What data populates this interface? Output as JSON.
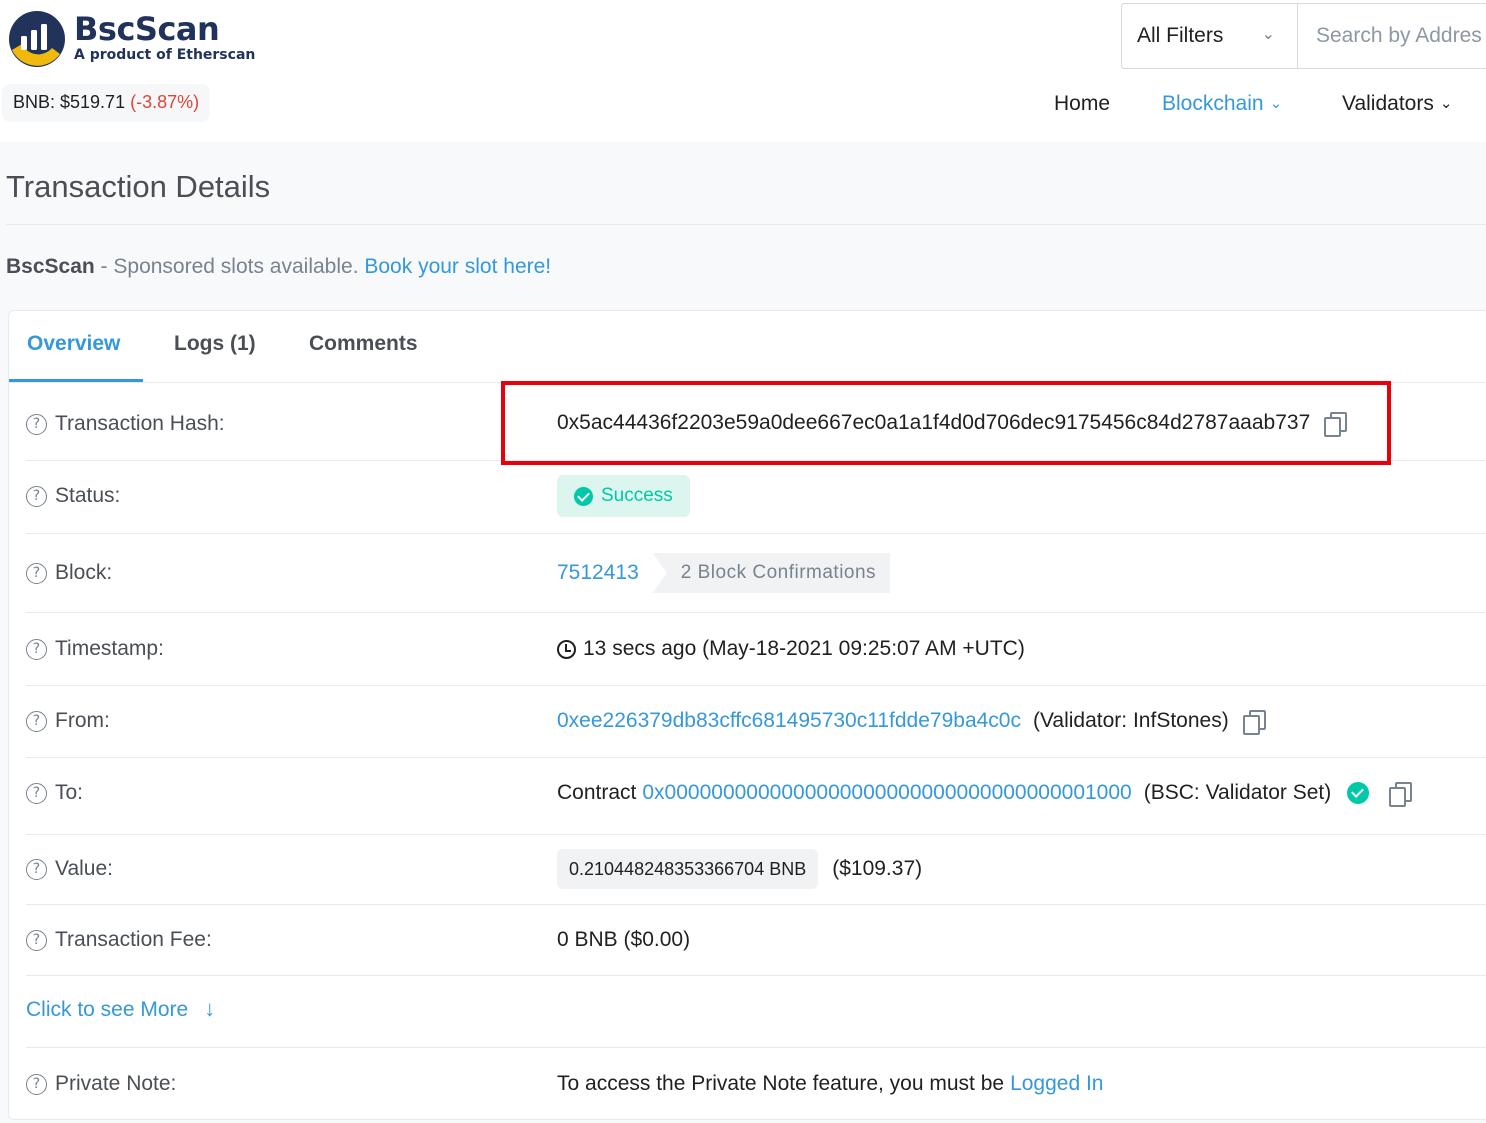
{
  "header": {
    "brand": "BscScan",
    "tagline": "A product of Etherscan",
    "price_label": "BNB: $519.71",
    "price_change": "(-3.87%)",
    "filter_label": "All Filters",
    "search_placeholder": "Search by Addres",
    "nav": [
      {
        "label": "Home"
      },
      {
        "label": "Blockchain"
      },
      {
        "label": "Validators"
      }
    ]
  },
  "page": {
    "title": "Transaction Details",
    "sponsor_brand": "BscScan",
    "sponsor_text": " - Sponsored slots available. ",
    "sponsor_link": "Book your slot here!"
  },
  "tabs": [
    {
      "label": "Overview"
    },
    {
      "label": "Logs (1)"
    },
    {
      "label": "Comments"
    }
  ],
  "details": {
    "hash": {
      "label": "Transaction Hash:",
      "value": "0x5ac44436f2203e59a0dee667ec0a1a1f4d0d706dec9175456c84d2787aaab737"
    },
    "status": {
      "label": "Status:",
      "value": "Success"
    },
    "block": {
      "label": "Block:",
      "number": "7512413",
      "confirmations": "2 Block Confirmations"
    },
    "timestamp": {
      "label": "Timestamp:",
      "value": "13 secs ago (May-18-2021 09:25:07 AM +UTC)"
    },
    "from": {
      "label": "From:",
      "address": "0xee226379db83cffc681495730c11fdde79ba4c0c",
      "name": "(Validator: InfStones)"
    },
    "to": {
      "label": "To:",
      "prefix": "Contract",
      "address": "0x0000000000000000000000000000000000001000",
      "name": "(BSC: Validator Set)"
    },
    "value": {
      "label": "Value:",
      "amount": "0.210448248353366704 BNB",
      "usd": "($109.37)"
    },
    "fee": {
      "label": "Transaction Fee:",
      "value": "0 BNB ($0.00)"
    },
    "more": "Click to see More",
    "note": {
      "label": "Private Note:",
      "text": "To access the Private Note feature, you must be ",
      "link": "Logged In"
    }
  },
  "colors": {
    "accent": "#3498db",
    "success": "#00c9a7",
    "negative": "#de4437",
    "highlight": "#e8000b"
  }
}
